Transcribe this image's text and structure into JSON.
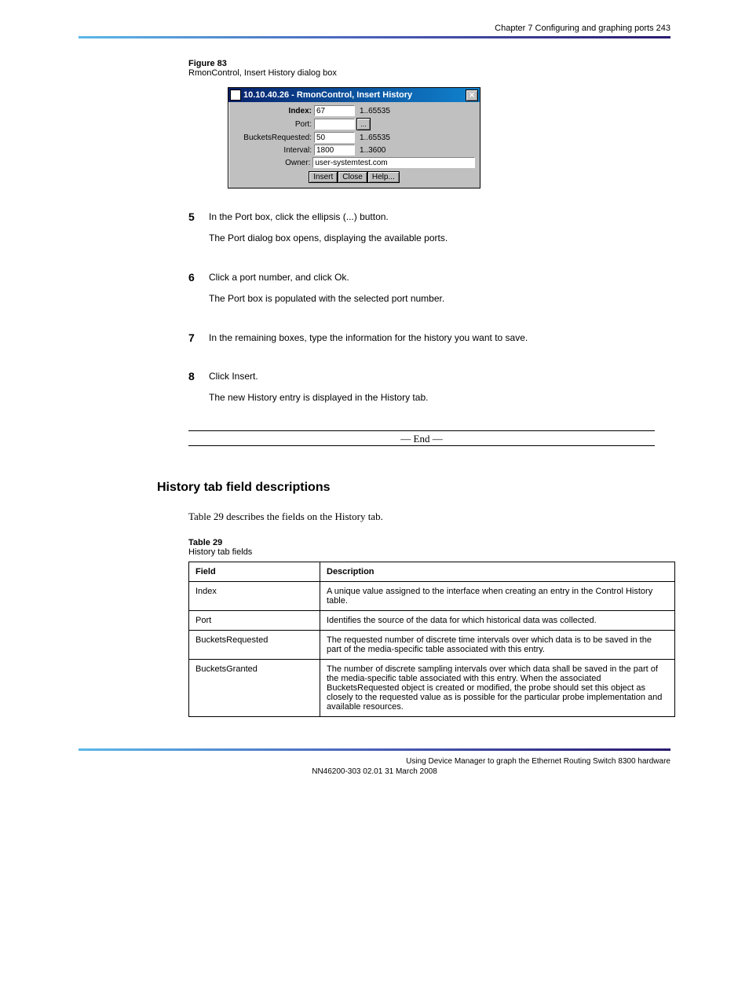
{
  "header": {
    "right": "Chapter 7 Configuring and graphing ports   243"
  },
  "figure": {
    "label": "Figure 83",
    "title": "RmonControl, Insert History dialog box"
  },
  "dialog": {
    "title": "10.10.40.26 - RmonControl, Insert History",
    "rows": {
      "index": {
        "label": "Index:",
        "value": "67",
        "range": "1..65535"
      },
      "port": {
        "label": "Port:",
        "value": "",
        "ellipsis": "..."
      },
      "buckets": {
        "label": "BucketsRequested:",
        "value": "50",
        "range": "1..65535"
      },
      "interval": {
        "label": "Interval:",
        "value": "1800",
        "range": "1..3600"
      },
      "owner": {
        "label": "Owner:",
        "value": "user-systemtest.com"
      }
    },
    "buttons": {
      "insert": "Insert",
      "close": "Close",
      "help": "Help..."
    }
  },
  "steps": [
    {
      "num": "5",
      "paras": [
        "In the Port box, click the ellipsis (...) button.",
        "The Port dialog box opens, displaying the available ports."
      ]
    },
    {
      "num": "6",
      "paras": [
        "Click a port number, and click Ok.",
        "The Port box is populated with the selected port number."
      ]
    },
    {
      "num": "7",
      "paras": [
        "In the remaining boxes, type the information for the history you want to save."
      ]
    },
    {
      "num": "8",
      "paras": [
        "Click Insert.",
        "The new History entry is displayed in the History tab."
      ]
    }
  ],
  "endText": "— End —",
  "section": {
    "title": "History tab field descriptions",
    "text1": "Table 29 describes the fields on the History tab.",
    "tableCaption": {
      "label": "Table 29",
      "title": "History tab fields"
    }
  },
  "table": {
    "headers": {
      "field": "Field",
      "desc": "Description"
    },
    "rows": [
      {
        "field": "Index",
        "desc": "A unique value assigned to the interface when creating an entry in the Control History table."
      },
      {
        "field": "Port",
        "desc": "Identifies the source of the data for which historical data was collected."
      },
      {
        "field": "BucketsRequested",
        "desc": "The requested number of discrete time intervals over which data is to be saved in the part of the media-specific table associated with this entry."
      },
      {
        "field": "BucketsGranted",
        "desc": "The number of discrete sampling intervals over which data shall be saved in the part of the media-specific table associated with this entry. When the associated BucketsRequested object is created or modified, the probe should set this object as closely to the requested value as is possible for the particular probe implementation and available resources."
      }
    ]
  },
  "footer": {
    "left": "",
    "right": "Using Device Manager to graph the Ethernet Routing Switch 8300 hardware",
    "date": "NN46200-303   02.01   31 March 2008"
  }
}
